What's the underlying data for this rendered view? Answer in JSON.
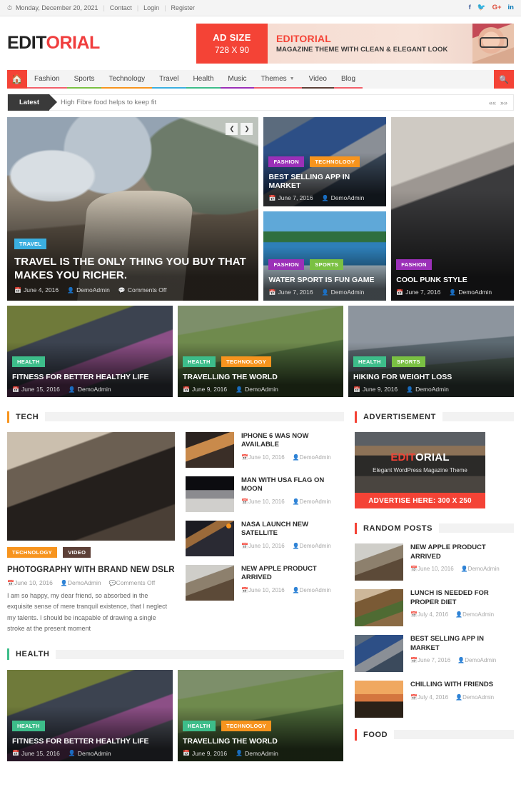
{
  "topbar": {
    "clock_icon": "clock-icon",
    "date": "Monday, December 20, 2021",
    "links": [
      {
        "label": "Contact"
      },
      {
        "label": "Login"
      },
      {
        "label": "Register"
      }
    ],
    "social": [
      {
        "name": "facebook-icon",
        "glyph": "f",
        "color": "#3b5998"
      },
      {
        "name": "twitter-icon",
        "glyph": "ᵛ",
        "color": "#3ab3e8"
      },
      {
        "name": "google-plus-icon",
        "glyph": "G+",
        "color": "#dd4b39"
      },
      {
        "name": "linkedin-icon",
        "glyph": "in",
        "color": "#0077b5"
      }
    ]
  },
  "header": {
    "logo_part1": "EDIT",
    "logo_part2": "ORIAL",
    "ad": {
      "size_label": "AD SIZE",
      "size_value": "728 X 90",
      "title": "EDITORIAL",
      "subtitle": "MAGAZINE THEME WITH CLEAN & ELEGANT LOOK"
    }
  },
  "nav": {
    "home_icon": "home-icon",
    "search_icon": "search-icon",
    "items": [
      {
        "label": "Fashion",
        "color": "#f2606a",
        "caret": false
      },
      {
        "label": "Sports",
        "color": "#7ac043",
        "caret": false
      },
      {
        "label": "Technology",
        "color": "#f7941e",
        "caret": false
      },
      {
        "label": "Travel",
        "color": "#3bafe0",
        "caret": false
      },
      {
        "label": "Health",
        "color": "#3dbd8a",
        "caret": false
      },
      {
        "label": "Music",
        "color": "#9b30b8",
        "caret": false
      },
      {
        "label": "Themes",
        "color": "#f2606a",
        "caret": true
      },
      {
        "label": "Video",
        "color": "#5d4037",
        "caret": false
      },
      {
        "label": "Blog",
        "color": "#f2606a",
        "caret": false
      }
    ]
  },
  "ticker": {
    "label": "Latest",
    "text": "High Fibre food helps to keep fit",
    "prev_icon": "double-chevron-left-icon",
    "next_icon": "double-chevron-right-icon"
  },
  "featured": {
    "slider_prev_icon": "chevron-left-icon",
    "slider_next_icon": "chevron-right-icon",
    "main": {
      "badges": [
        {
          "label": "TRAVEL",
          "color": "#3bafe0"
        }
      ],
      "title": "TRAVEL IS THE ONLY THING YOU BUY THAT MAKES YOU RICHER.",
      "date": "June 4, 2016",
      "author": "DemoAdmin",
      "comments": "Comments Off"
    },
    "small": [
      {
        "badges": [
          {
            "label": "FASHION",
            "color": "#9b30b8"
          },
          {
            "label": "TECHNOLOGY",
            "color": "#f7941e"
          }
        ],
        "title": "BEST SELLING APP IN MARKET",
        "date": "June 7, 2016",
        "author": "DemoAdmin",
        "image": "img-app"
      },
      {
        "badges": [
          {
            "label": "FASHION",
            "color": "#9b30b8"
          },
          {
            "label": "SPORTS",
            "color": "#7ac043"
          }
        ],
        "title": "WATER SPORT IS FUN GAME",
        "date": "June 7, 2016",
        "author": "DemoAdmin",
        "image": "img-water"
      }
    ],
    "tall": {
      "badges": [
        {
          "label": "FASHION",
          "color": "#9b30b8"
        }
      ],
      "title": "COOL PUNK STYLE",
      "date": "June 7, 2016",
      "author": "DemoAdmin",
      "image": "img-punk"
    }
  },
  "triple": [
    {
      "badges": [
        {
          "label": "HEALTH",
          "color": "#3dbd8a"
        }
      ],
      "title": "FITNESS FOR BETTER HEALTHY LIFE",
      "date": "June 15, 2016",
      "author": "DemoAdmin",
      "image": "img-fitness"
    },
    {
      "badges": [
        {
          "label": "HEALTH",
          "color": "#3dbd8a"
        },
        {
          "label": "TECHNOLOGY",
          "color": "#f7941e"
        }
      ],
      "title": "TRAVELLING THE WORLD",
      "date": "June 9, 2016",
      "author": "DemoAdmin",
      "image": "img-travel2"
    },
    {
      "badges": [
        {
          "label": "HEALTH",
          "color": "#3dbd8a"
        },
        {
          "label": "SPORTS",
          "color": "#7ac043"
        }
      ],
      "title": "HIKING FOR WEIGHT LOSS",
      "date": "June 9, 2016",
      "author": "DemoAdmin",
      "image": "img-hike"
    }
  ],
  "tech_section": {
    "heading": "TECH",
    "heading_color": "#f7941e",
    "feature": {
      "badges": [
        {
          "label": "TECHNOLOGY",
          "color": "#f7941e"
        },
        {
          "label": "VIDEO",
          "color": "#5d4037"
        }
      ],
      "title": "PHOTOGRAPHY WITH BRAND NEW DSLR",
      "date": "June 10, 2016",
      "author": "DemoAdmin",
      "comments": "Comments Off",
      "excerpt": "I am so happy, my dear friend, so absorbed in the exquisite sense of mere tranquil existence, that I neglect my talents. I should be incapable of drawing a single stroke at the present moment"
    },
    "posts": [
      {
        "title": "IPHONE 6 WAS NOW AVAILABLE",
        "date": "June 10, 2016",
        "author": "DemoAdmin",
        "image": "img-iphone",
        "video": false
      },
      {
        "title": "MAN WITH USA FLAG ON MOON",
        "date": "June 10, 2016",
        "author": "DemoAdmin",
        "image": "img-moon",
        "video": false
      },
      {
        "title": "NASA LAUNCH NEW SATELLITE",
        "date": "June 10, 2016",
        "author": "DemoAdmin",
        "image": "img-sat",
        "video": true
      },
      {
        "title": "NEW APPLE PRODUCT ARRIVED",
        "date": "June 10, 2016",
        "author": "DemoAdmin",
        "image": "img-apple",
        "video": false
      }
    ]
  },
  "health_section": {
    "heading": "HEALTH",
    "heading_color": "#3dbd8a",
    "cards": [
      {
        "badges": [
          {
            "label": "HEALTH",
            "color": "#3dbd8a"
          }
        ],
        "title": "FITNESS FOR BETTER HEALTHY LIFE",
        "date": "June 15, 2016",
        "author": "DemoAdmin",
        "image": "img-fitness"
      },
      {
        "badges": [
          {
            "label": "HEALTH",
            "color": "#3dbd8a"
          },
          {
            "label": "TECHNOLOGY",
            "color": "#f7941e"
          }
        ],
        "title": "TRAVELLING THE WORLD",
        "date": "June 9, 2016",
        "author": "DemoAdmin",
        "image": "img-travel2"
      }
    ]
  },
  "sidebar": {
    "advertisement": {
      "heading": "ADVERTISEMENT",
      "heading_color": "#f44336",
      "logo_part1": "EDIT",
      "logo_part2": "ORIAL",
      "tagline": "Elegant WordPress Magazine Theme",
      "cta": "ADVERTISE HERE: 300 X 250"
    },
    "random_posts": {
      "heading": "RANDOM POSTS",
      "heading_color": "#f44336",
      "items": [
        {
          "title": "NEW APPLE PRODUCT ARRIVED",
          "date": "June 10, 2016",
          "author": "DemoAdmin",
          "image": "img-apple"
        },
        {
          "title": "LUNCH IS NEEDED FOR PROPER DIET",
          "date": "July 4, 2016",
          "author": "DemoAdmin",
          "image": "img-food"
        },
        {
          "title": "BEST SELLING APP IN MARKET",
          "date": "June 7, 2016",
          "author": "DemoAdmin",
          "image": "img-app"
        },
        {
          "title": "CHILLING WITH FRIENDS",
          "date": "July 4, 2016",
          "author": "DemoAdmin",
          "image": "img-chill"
        }
      ]
    },
    "food": {
      "heading": "FOOD",
      "heading_color": "#f44336"
    }
  },
  "icons": {
    "calendar": "📅",
    "user": "👤",
    "comment": "💬"
  }
}
